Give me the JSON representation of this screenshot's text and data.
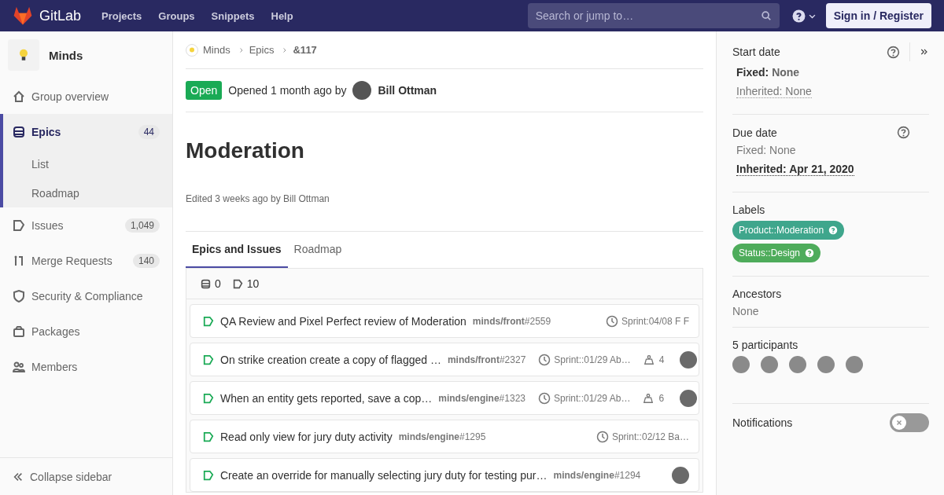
{
  "navbar": {
    "brand": "GitLab",
    "links": [
      "Projects",
      "Groups",
      "Snippets",
      "Help"
    ],
    "search": {
      "placeholder": "Search or jump to…"
    },
    "sign_in": "Sign in / Register"
  },
  "sidebar": {
    "group": "Minds",
    "items": [
      {
        "kind": "overview",
        "label": "Group overview",
        "selected": false
      },
      {
        "kind": "epics",
        "label": "Epics",
        "count": "44",
        "selected": true,
        "expanded": true,
        "children": [
          {
            "label": "List",
            "selected": false
          },
          {
            "label": "Roadmap",
            "selected": false
          }
        ]
      },
      {
        "kind": "issues",
        "label": "Issues",
        "count": "1,049",
        "selected": false
      },
      {
        "kind": "merge",
        "label": "Merge Requests",
        "count": "140",
        "selected": false
      },
      {
        "kind": "security",
        "label": "Security & Compliance",
        "selected": false
      },
      {
        "kind": "packages",
        "label": "Packages",
        "selected": false
      },
      {
        "kind": "members",
        "label": "Members",
        "selected": false
      }
    ],
    "collapse": "Collapse sidebar"
  },
  "breadcrumbs": [
    "Minds",
    "Epics",
    "&117"
  ],
  "status": {
    "badge": "Open",
    "text": "Opened 1 month ago by",
    "author": "Bill Ottman"
  },
  "title": "Moderation",
  "edited": "Edited 3 weeks ago by Bill Ottman",
  "tabs": [
    {
      "label": "Epics and Issues",
      "selected": true
    },
    {
      "label": "Roadmap",
      "selected": false
    }
  ],
  "counts": {
    "epics": "0",
    "issues": "10"
  },
  "issues": [
    {
      "title": "QA Review and Pixel Perfect review of Moderation",
      "project": "minds/front",
      "number": "#2559",
      "milestone": "Sprint:04/08 F F",
      "assignee": false
    },
    {
      "title": "On strike creation create a copy of flagged …",
      "project": "minds/front",
      "number": "#2327",
      "milestone": "Sprint::01/29 Ab…",
      "weight": "4",
      "assignee": true
    },
    {
      "title": "When an entity gets reported, save a cop…",
      "project": "minds/engine",
      "number": "#1323",
      "milestone": "Sprint::01/29 Ab…",
      "weight": "6",
      "assignee": true
    },
    {
      "title": "Read only view for jury duty activity",
      "project": "minds/engine",
      "number": "#1295",
      "milestone": "Sprint::02/12 Ba…",
      "assignee": false
    },
    {
      "title": "Create an override for manually selecting jury duty for testing pur…",
      "project": "minds/engine",
      "number": "#1294",
      "assignee": true
    }
  ],
  "dates": [
    {
      "label": "Start date",
      "fixed": {
        "label": "Fixed:",
        "value": "None",
        "selected": true
      },
      "inherited": {
        "label": "Inherited:",
        "value": "None",
        "selected": false
      }
    },
    {
      "label": "Due date",
      "fixed": {
        "label": "Fixed:",
        "value": "None",
        "selected": false
      },
      "inherited": {
        "label": "Inherited:",
        "value": "Apr 21, 2020",
        "selected": true
      }
    }
  ],
  "labels_title": "Labels",
  "labels": [
    {
      "text": "Product::Moderation",
      "color": "#3fa68c"
    },
    {
      "text": "Status::Design",
      "color": "#4eac5b"
    }
  ],
  "ancestors": {
    "label": "Ancestors",
    "value": "None"
  },
  "participants": {
    "label": "5 participants",
    "avatars": [
      {
        "kind": "photo"
      },
      {
        "kind": "photo"
      },
      {
        "kind": "photo"
      },
      {
        "kind": "photo"
      },
      {
        "kind": "photo"
      }
    ]
  },
  "notifications": {
    "label": "Notifications",
    "on": false
  }
}
